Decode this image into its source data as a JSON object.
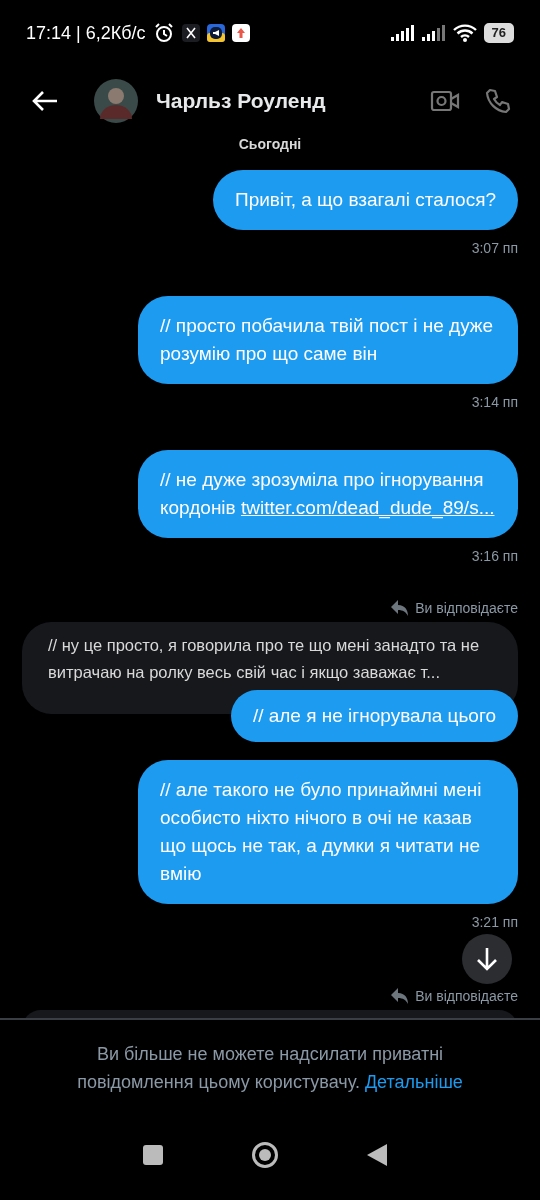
{
  "status_bar": {
    "time": "17:14",
    "speed": "| 6,2Кб/с",
    "battery": "76"
  },
  "header": {
    "name": "Чарльз Роуленд"
  },
  "messages": [
    {
      "kind": "date",
      "text": "Сьогодні"
    },
    {
      "kind": "outgoing",
      "text": "Привіт, а що взагалі сталося?"
    },
    {
      "kind": "time",
      "text": "3:07 пп"
    },
    {
      "kind": "outgoing",
      "text": "// просто побачила твій пост і не дуже розумію про що саме він"
    },
    {
      "kind": "time",
      "text": "3:14 пп"
    },
    {
      "kind": "outgoing",
      "text": "// не дуже зрозуміла про ігнорування кордонів ",
      "link": "twitter.com/dead_dude_89/s..."
    },
    {
      "kind": "time",
      "text": "3:16 пп"
    },
    {
      "kind": "reply_label",
      "text": "Ви відповідаєте"
    },
    {
      "kind": "incoming",
      "text": "// ну це просто, я говорила про те що мені занадто та не витрачаю на ролку весь свій час і якщо заважає т..."
    },
    {
      "kind": "outgoing",
      "text": "// але я не ігнорувала цього",
      "overlap": true
    },
    {
      "kind": "outgoing",
      "text": "// але такого не було принаймні мені особисто ніхто нічого в очі не казав що щось не так, а думки я читати не вмію"
    },
    {
      "kind": "time",
      "text": "3:21 пп"
    },
    {
      "kind": "scroll_button"
    },
    {
      "kind": "reply_label",
      "text": "Ви відповідаєте"
    },
    {
      "kind": "incoming"
    }
  ],
  "notice": {
    "text": "Ви більше не можете надсилати приватні повідомлення цьому користувачу. ",
    "link": "Детальніше"
  }
}
